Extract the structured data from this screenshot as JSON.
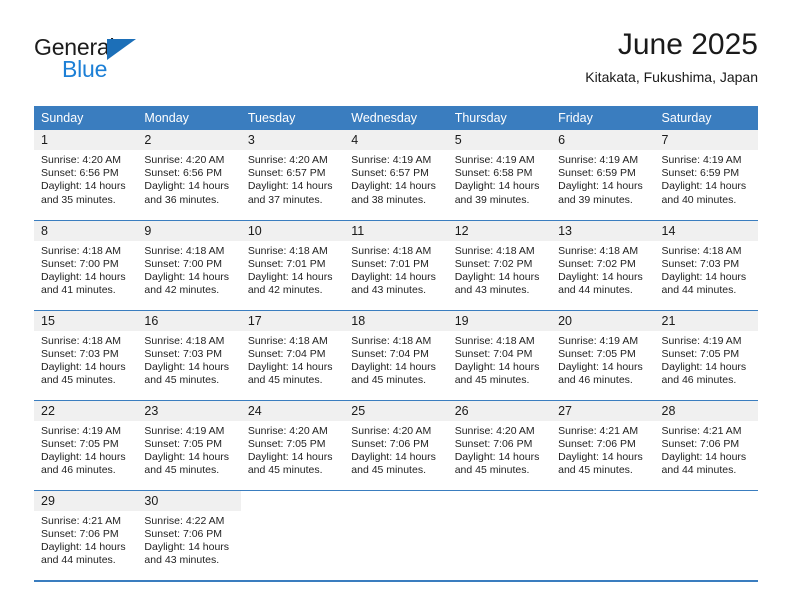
{
  "brand": {
    "name_top": "General",
    "name_bottom": "Blue"
  },
  "header": {
    "title": "June 2025",
    "subtitle": "Kitakata, Fukushima, Japan"
  },
  "calendar": {
    "weekday_headers": [
      "Sunday",
      "Monday",
      "Tuesday",
      "Wednesday",
      "Thursday",
      "Friday",
      "Saturday"
    ],
    "accent_color": "#3a7dbf",
    "daynum_band_color": "#f0f0f0",
    "weeks": [
      [
        {
          "day": "1",
          "sunrise": "Sunrise: 4:20 AM",
          "sunset": "Sunset: 6:56 PM",
          "daylight_line1": "Daylight: 14 hours",
          "daylight_line2": "and 35 minutes."
        },
        {
          "day": "2",
          "sunrise": "Sunrise: 4:20 AM",
          "sunset": "Sunset: 6:56 PM",
          "daylight_line1": "Daylight: 14 hours",
          "daylight_line2": "and 36 minutes."
        },
        {
          "day": "3",
          "sunrise": "Sunrise: 4:20 AM",
          "sunset": "Sunset: 6:57 PM",
          "daylight_line1": "Daylight: 14 hours",
          "daylight_line2": "and 37 minutes."
        },
        {
          "day": "4",
          "sunrise": "Sunrise: 4:19 AM",
          "sunset": "Sunset: 6:57 PM",
          "daylight_line1": "Daylight: 14 hours",
          "daylight_line2": "and 38 minutes."
        },
        {
          "day": "5",
          "sunrise": "Sunrise: 4:19 AM",
          "sunset": "Sunset: 6:58 PM",
          "daylight_line1": "Daylight: 14 hours",
          "daylight_line2": "and 39 minutes."
        },
        {
          "day": "6",
          "sunrise": "Sunrise: 4:19 AM",
          "sunset": "Sunset: 6:59 PM",
          "daylight_line1": "Daylight: 14 hours",
          "daylight_line2": "and 39 minutes."
        },
        {
          "day": "7",
          "sunrise": "Sunrise: 4:19 AM",
          "sunset": "Sunset: 6:59 PM",
          "daylight_line1": "Daylight: 14 hours",
          "daylight_line2": "and 40 minutes."
        }
      ],
      [
        {
          "day": "8",
          "sunrise": "Sunrise: 4:18 AM",
          "sunset": "Sunset: 7:00 PM",
          "daylight_line1": "Daylight: 14 hours",
          "daylight_line2": "and 41 minutes."
        },
        {
          "day": "9",
          "sunrise": "Sunrise: 4:18 AM",
          "sunset": "Sunset: 7:00 PM",
          "daylight_line1": "Daylight: 14 hours",
          "daylight_line2": "and 42 minutes."
        },
        {
          "day": "10",
          "sunrise": "Sunrise: 4:18 AM",
          "sunset": "Sunset: 7:01 PM",
          "daylight_line1": "Daylight: 14 hours",
          "daylight_line2": "and 42 minutes."
        },
        {
          "day": "11",
          "sunrise": "Sunrise: 4:18 AM",
          "sunset": "Sunset: 7:01 PM",
          "daylight_line1": "Daylight: 14 hours",
          "daylight_line2": "and 43 minutes."
        },
        {
          "day": "12",
          "sunrise": "Sunrise: 4:18 AM",
          "sunset": "Sunset: 7:02 PM",
          "daylight_line1": "Daylight: 14 hours",
          "daylight_line2": "and 43 minutes."
        },
        {
          "day": "13",
          "sunrise": "Sunrise: 4:18 AM",
          "sunset": "Sunset: 7:02 PM",
          "daylight_line1": "Daylight: 14 hours",
          "daylight_line2": "and 44 minutes."
        },
        {
          "day": "14",
          "sunrise": "Sunrise: 4:18 AM",
          "sunset": "Sunset: 7:03 PM",
          "daylight_line1": "Daylight: 14 hours",
          "daylight_line2": "and 44 minutes."
        }
      ],
      [
        {
          "day": "15",
          "sunrise": "Sunrise: 4:18 AM",
          "sunset": "Sunset: 7:03 PM",
          "daylight_line1": "Daylight: 14 hours",
          "daylight_line2": "and 45 minutes."
        },
        {
          "day": "16",
          "sunrise": "Sunrise: 4:18 AM",
          "sunset": "Sunset: 7:03 PM",
          "daylight_line1": "Daylight: 14 hours",
          "daylight_line2": "and 45 minutes."
        },
        {
          "day": "17",
          "sunrise": "Sunrise: 4:18 AM",
          "sunset": "Sunset: 7:04 PM",
          "daylight_line1": "Daylight: 14 hours",
          "daylight_line2": "and 45 minutes."
        },
        {
          "day": "18",
          "sunrise": "Sunrise: 4:18 AM",
          "sunset": "Sunset: 7:04 PM",
          "daylight_line1": "Daylight: 14 hours",
          "daylight_line2": "and 45 minutes."
        },
        {
          "day": "19",
          "sunrise": "Sunrise: 4:18 AM",
          "sunset": "Sunset: 7:04 PM",
          "daylight_line1": "Daylight: 14 hours",
          "daylight_line2": "and 45 minutes."
        },
        {
          "day": "20",
          "sunrise": "Sunrise: 4:19 AM",
          "sunset": "Sunset: 7:05 PM",
          "daylight_line1": "Daylight: 14 hours",
          "daylight_line2": "and 46 minutes."
        },
        {
          "day": "21",
          "sunrise": "Sunrise: 4:19 AM",
          "sunset": "Sunset: 7:05 PM",
          "daylight_line1": "Daylight: 14 hours",
          "daylight_line2": "and 46 minutes."
        }
      ],
      [
        {
          "day": "22",
          "sunrise": "Sunrise: 4:19 AM",
          "sunset": "Sunset: 7:05 PM",
          "daylight_line1": "Daylight: 14 hours",
          "daylight_line2": "and 46 minutes."
        },
        {
          "day": "23",
          "sunrise": "Sunrise: 4:19 AM",
          "sunset": "Sunset: 7:05 PM",
          "daylight_line1": "Daylight: 14 hours",
          "daylight_line2": "and 45 minutes."
        },
        {
          "day": "24",
          "sunrise": "Sunrise: 4:20 AM",
          "sunset": "Sunset: 7:05 PM",
          "daylight_line1": "Daylight: 14 hours",
          "daylight_line2": "and 45 minutes."
        },
        {
          "day": "25",
          "sunrise": "Sunrise: 4:20 AM",
          "sunset": "Sunset: 7:06 PM",
          "daylight_line1": "Daylight: 14 hours",
          "daylight_line2": "and 45 minutes."
        },
        {
          "day": "26",
          "sunrise": "Sunrise: 4:20 AM",
          "sunset": "Sunset: 7:06 PM",
          "daylight_line1": "Daylight: 14 hours",
          "daylight_line2": "and 45 minutes."
        },
        {
          "day": "27",
          "sunrise": "Sunrise: 4:21 AM",
          "sunset": "Sunset: 7:06 PM",
          "daylight_line1": "Daylight: 14 hours",
          "daylight_line2": "and 45 minutes."
        },
        {
          "day": "28",
          "sunrise": "Sunrise: 4:21 AM",
          "sunset": "Sunset: 7:06 PM",
          "daylight_line1": "Daylight: 14 hours",
          "daylight_line2": "and 44 minutes."
        }
      ],
      [
        {
          "day": "29",
          "sunrise": "Sunrise: 4:21 AM",
          "sunset": "Sunset: 7:06 PM",
          "daylight_line1": "Daylight: 14 hours",
          "daylight_line2": "and 44 minutes."
        },
        {
          "day": "30",
          "sunrise": "Sunrise: 4:22 AM",
          "sunset": "Sunset: 7:06 PM",
          "daylight_line1": "Daylight: 14 hours",
          "daylight_line2": "and 43 minutes."
        },
        {
          "day": "",
          "sunrise": "",
          "sunset": "",
          "daylight_line1": "",
          "daylight_line2": ""
        },
        {
          "day": "",
          "sunrise": "",
          "sunset": "",
          "daylight_line1": "",
          "daylight_line2": ""
        },
        {
          "day": "",
          "sunrise": "",
          "sunset": "",
          "daylight_line1": "",
          "daylight_line2": ""
        },
        {
          "day": "",
          "sunrise": "",
          "sunset": "",
          "daylight_line1": "",
          "daylight_line2": ""
        },
        {
          "day": "",
          "sunrise": "",
          "sunset": "",
          "daylight_line1": "",
          "daylight_line2": ""
        }
      ]
    ]
  }
}
